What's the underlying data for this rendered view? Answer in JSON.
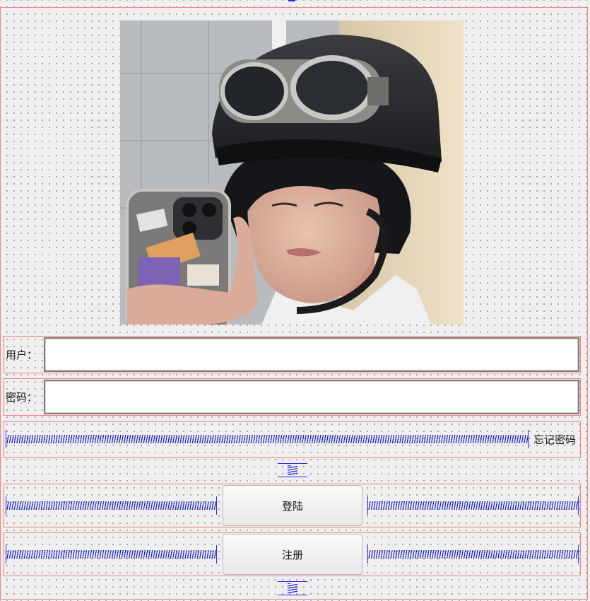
{
  "form": {
    "user_label": "用户：",
    "user_value": "",
    "password_label": "密码：",
    "password_value": "",
    "forgot_password": "忘记密码",
    "login_button": "登陆",
    "register_button": "注册"
  },
  "icons": {
    "spacer": "spring-spacer-icon"
  },
  "colors": {
    "layout_outline": "#f08080",
    "spacer": "#1a1ad0",
    "canvas": "#efefef"
  }
}
